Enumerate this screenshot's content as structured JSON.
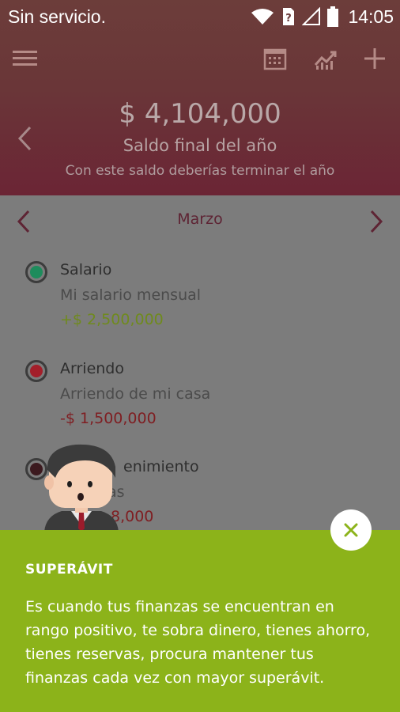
{
  "status_bar": {
    "carrier": "Sin servicio.",
    "time": "14:05"
  },
  "toolbar": {
    "menu_icon": "menu-icon",
    "calendar_icon": "calendar-icon",
    "chart_icon": "trend-chart-icon",
    "add_icon": "plus-icon"
  },
  "summary": {
    "balance": "$ 4,104,000",
    "label": "Saldo final del año",
    "sublabel": "Con este saldo deberías terminar el año"
  },
  "month": {
    "title": "Marzo"
  },
  "items": [
    {
      "title": "Salario",
      "description": "Mi salario mensual",
      "amount": "+$ 2,500,000",
      "color": "#1e8c5c",
      "amount_color": "#6f8a1d"
    },
    {
      "title": "Arriendo",
      "description": "Arriendo de mi casa",
      "amount": "-$ 1,500,000",
      "color": "#a31f2a",
      "amount_color": "#7f1e22"
    },
    {
      "title": "enimiento",
      "description": "as",
      "amount": "8,000",
      "color": "#3c1a1f",
      "amount_color": "#7f1e22"
    }
  ],
  "tip": {
    "title": "SUPERÁVIT",
    "body": "Es cuando tus finanzas se encuentran en rango positivo, te sobra dinero, tienes ahorro, tienes reservas, procura mantener tus finanzas cada vez con mayor superávit."
  },
  "colors": {
    "tip_bg": "#8cb31a",
    "accent": "#6b2535"
  }
}
